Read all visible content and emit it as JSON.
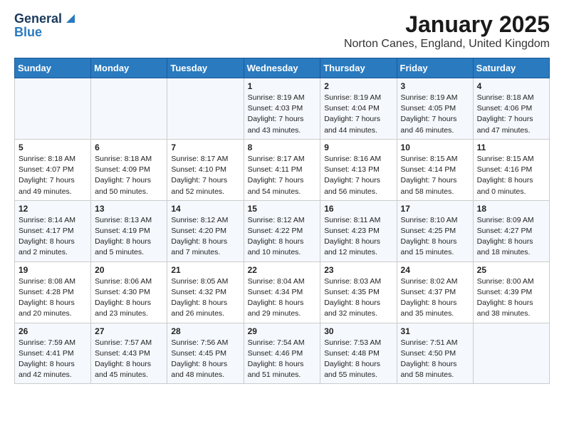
{
  "logo": {
    "general": "General",
    "blue": "Blue"
  },
  "title": "January 2025",
  "subtitle": "Norton Canes, England, United Kingdom",
  "days_of_week": [
    "Sunday",
    "Monday",
    "Tuesday",
    "Wednesday",
    "Thursday",
    "Friday",
    "Saturday"
  ],
  "weeks": [
    [
      {
        "day": "",
        "info": ""
      },
      {
        "day": "",
        "info": ""
      },
      {
        "day": "",
        "info": ""
      },
      {
        "day": "1",
        "info": "Sunrise: 8:19 AM\nSunset: 4:03 PM\nDaylight: 7 hours\nand 43 minutes."
      },
      {
        "day": "2",
        "info": "Sunrise: 8:19 AM\nSunset: 4:04 PM\nDaylight: 7 hours\nand 44 minutes."
      },
      {
        "day": "3",
        "info": "Sunrise: 8:19 AM\nSunset: 4:05 PM\nDaylight: 7 hours\nand 46 minutes."
      },
      {
        "day": "4",
        "info": "Sunrise: 8:18 AM\nSunset: 4:06 PM\nDaylight: 7 hours\nand 47 minutes."
      }
    ],
    [
      {
        "day": "5",
        "info": "Sunrise: 8:18 AM\nSunset: 4:07 PM\nDaylight: 7 hours\nand 49 minutes."
      },
      {
        "day": "6",
        "info": "Sunrise: 8:18 AM\nSunset: 4:09 PM\nDaylight: 7 hours\nand 50 minutes."
      },
      {
        "day": "7",
        "info": "Sunrise: 8:17 AM\nSunset: 4:10 PM\nDaylight: 7 hours\nand 52 minutes."
      },
      {
        "day": "8",
        "info": "Sunrise: 8:17 AM\nSunset: 4:11 PM\nDaylight: 7 hours\nand 54 minutes."
      },
      {
        "day": "9",
        "info": "Sunrise: 8:16 AM\nSunset: 4:13 PM\nDaylight: 7 hours\nand 56 minutes."
      },
      {
        "day": "10",
        "info": "Sunrise: 8:15 AM\nSunset: 4:14 PM\nDaylight: 7 hours\nand 58 minutes."
      },
      {
        "day": "11",
        "info": "Sunrise: 8:15 AM\nSunset: 4:16 PM\nDaylight: 8 hours\nand 0 minutes."
      }
    ],
    [
      {
        "day": "12",
        "info": "Sunrise: 8:14 AM\nSunset: 4:17 PM\nDaylight: 8 hours\nand 2 minutes."
      },
      {
        "day": "13",
        "info": "Sunrise: 8:13 AM\nSunset: 4:19 PM\nDaylight: 8 hours\nand 5 minutes."
      },
      {
        "day": "14",
        "info": "Sunrise: 8:12 AM\nSunset: 4:20 PM\nDaylight: 8 hours\nand 7 minutes."
      },
      {
        "day": "15",
        "info": "Sunrise: 8:12 AM\nSunset: 4:22 PM\nDaylight: 8 hours\nand 10 minutes."
      },
      {
        "day": "16",
        "info": "Sunrise: 8:11 AM\nSunset: 4:23 PM\nDaylight: 8 hours\nand 12 minutes."
      },
      {
        "day": "17",
        "info": "Sunrise: 8:10 AM\nSunset: 4:25 PM\nDaylight: 8 hours\nand 15 minutes."
      },
      {
        "day": "18",
        "info": "Sunrise: 8:09 AM\nSunset: 4:27 PM\nDaylight: 8 hours\nand 18 minutes."
      }
    ],
    [
      {
        "day": "19",
        "info": "Sunrise: 8:08 AM\nSunset: 4:28 PM\nDaylight: 8 hours\nand 20 minutes."
      },
      {
        "day": "20",
        "info": "Sunrise: 8:06 AM\nSunset: 4:30 PM\nDaylight: 8 hours\nand 23 minutes."
      },
      {
        "day": "21",
        "info": "Sunrise: 8:05 AM\nSunset: 4:32 PM\nDaylight: 8 hours\nand 26 minutes."
      },
      {
        "day": "22",
        "info": "Sunrise: 8:04 AM\nSunset: 4:34 PM\nDaylight: 8 hours\nand 29 minutes."
      },
      {
        "day": "23",
        "info": "Sunrise: 8:03 AM\nSunset: 4:35 PM\nDaylight: 8 hours\nand 32 minutes."
      },
      {
        "day": "24",
        "info": "Sunrise: 8:02 AM\nSunset: 4:37 PM\nDaylight: 8 hours\nand 35 minutes."
      },
      {
        "day": "25",
        "info": "Sunrise: 8:00 AM\nSunset: 4:39 PM\nDaylight: 8 hours\nand 38 minutes."
      }
    ],
    [
      {
        "day": "26",
        "info": "Sunrise: 7:59 AM\nSunset: 4:41 PM\nDaylight: 8 hours\nand 42 minutes."
      },
      {
        "day": "27",
        "info": "Sunrise: 7:57 AM\nSunset: 4:43 PM\nDaylight: 8 hours\nand 45 minutes."
      },
      {
        "day": "28",
        "info": "Sunrise: 7:56 AM\nSunset: 4:45 PM\nDaylight: 8 hours\nand 48 minutes."
      },
      {
        "day": "29",
        "info": "Sunrise: 7:54 AM\nSunset: 4:46 PM\nDaylight: 8 hours\nand 51 minutes."
      },
      {
        "day": "30",
        "info": "Sunrise: 7:53 AM\nSunset: 4:48 PM\nDaylight: 8 hours\nand 55 minutes."
      },
      {
        "day": "31",
        "info": "Sunrise: 7:51 AM\nSunset: 4:50 PM\nDaylight: 8 hours\nand 58 minutes."
      },
      {
        "day": "",
        "info": ""
      }
    ]
  ]
}
